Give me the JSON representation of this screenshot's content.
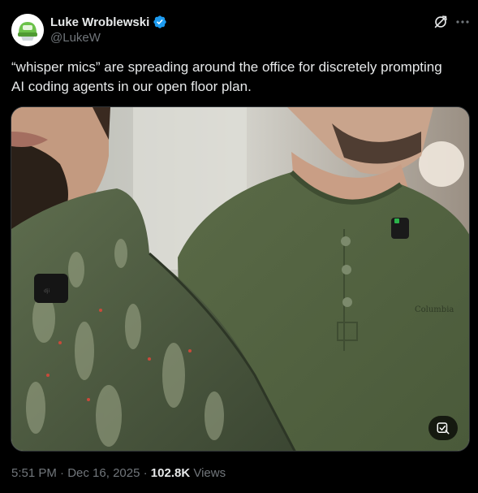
{
  "author": {
    "display_name": "Luke Wroblewski",
    "handle": "@LukeW",
    "verified": true,
    "avatar_icon": "avatar-green-helmet",
    "verified_color": "#1d9bf0"
  },
  "header_icons": {
    "grok": "grok-icon",
    "more": "more-icon"
  },
  "tweet": {
    "text": "“whisper mics” are spreading around the office for discretely prompting\nAI coding agents in our open floor plan."
  },
  "media": {
    "icon": "photo",
    "badge_icon": "edit-image-icon"
  },
  "meta": {
    "time": "5:51 PM",
    "separator": "·",
    "date": "Dec 16, 2025",
    "views_count": "102.8K",
    "views_label": "Views"
  },
  "colors": {
    "background": "#000000",
    "text_primary": "#e7e9ea",
    "text_secondary": "#71767b",
    "border": "#2f3336"
  }
}
